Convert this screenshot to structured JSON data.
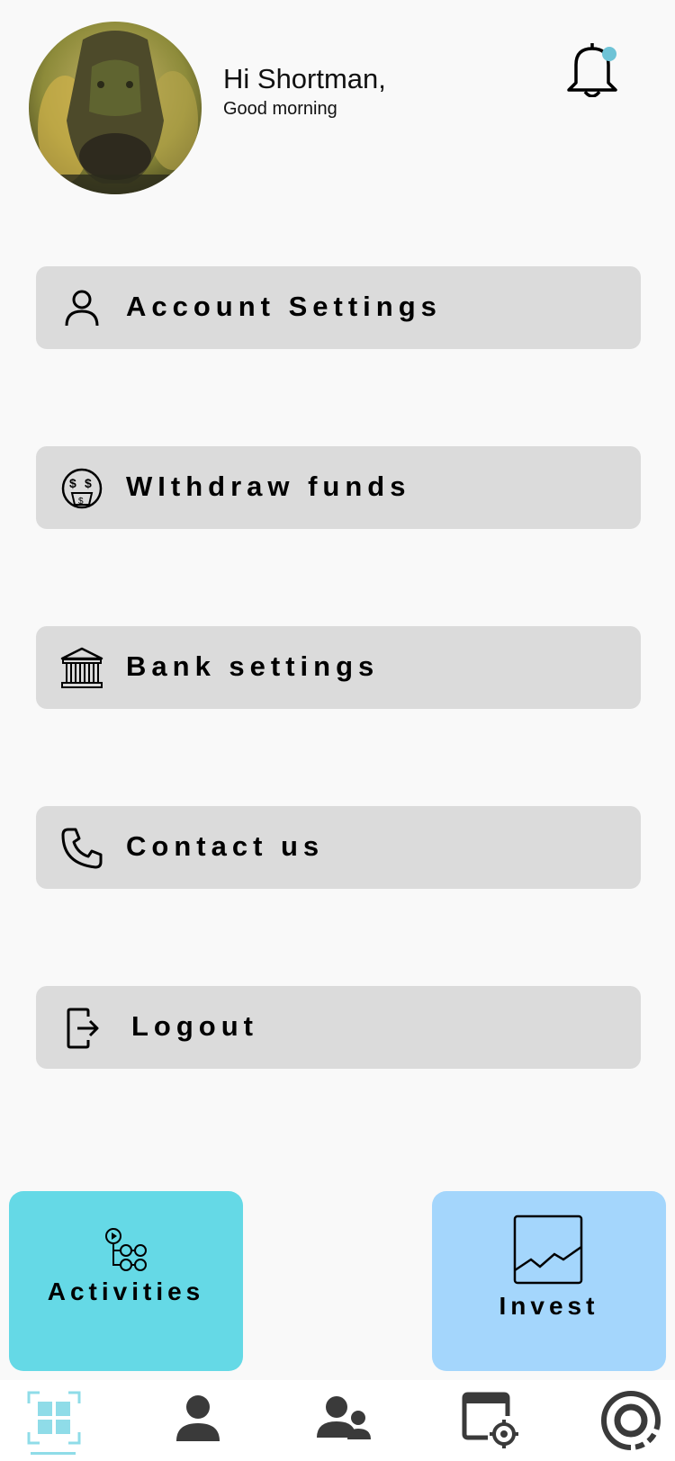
{
  "header": {
    "greeting": "Hi Shortman,",
    "subgreeting": "Good morning",
    "avatar_icon": "profile-photo",
    "notification_icon": "bell-icon",
    "notification_dot_color": "#6ec3d6"
  },
  "menu": {
    "items": [
      {
        "label": "Account Settings",
        "icon": "user-icon"
      },
      {
        "label": "WIthdraw funds",
        "icon": "money-face-icon"
      },
      {
        "label": "Bank settings",
        "icon": "bank-icon"
      },
      {
        "label": "Contact us",
        "icon": "phone-icon"
      },
      {
        "label": "Logout",
        "icon": "logout-icon"
      }
    ]
  },
  "cards": {
    "activities": {
      "label": "Activities",
      "icon": "workflow-icon",
      "color": "#65d9e6"
    },
    "invest": {
      "label": "Invest",
      "icon": "chart-icon",
      "color": "#a4d6fc"
    }
  },
  "bottom_nav": {
    "items": [
      "dashboard-icon",
      "person-icon",
      "people-icon",
      "browser-target-icon",
      "settings-ring-icon"
    ],
    "active_index": 0,
    "active_color": "#8fdce8"
  }
}
